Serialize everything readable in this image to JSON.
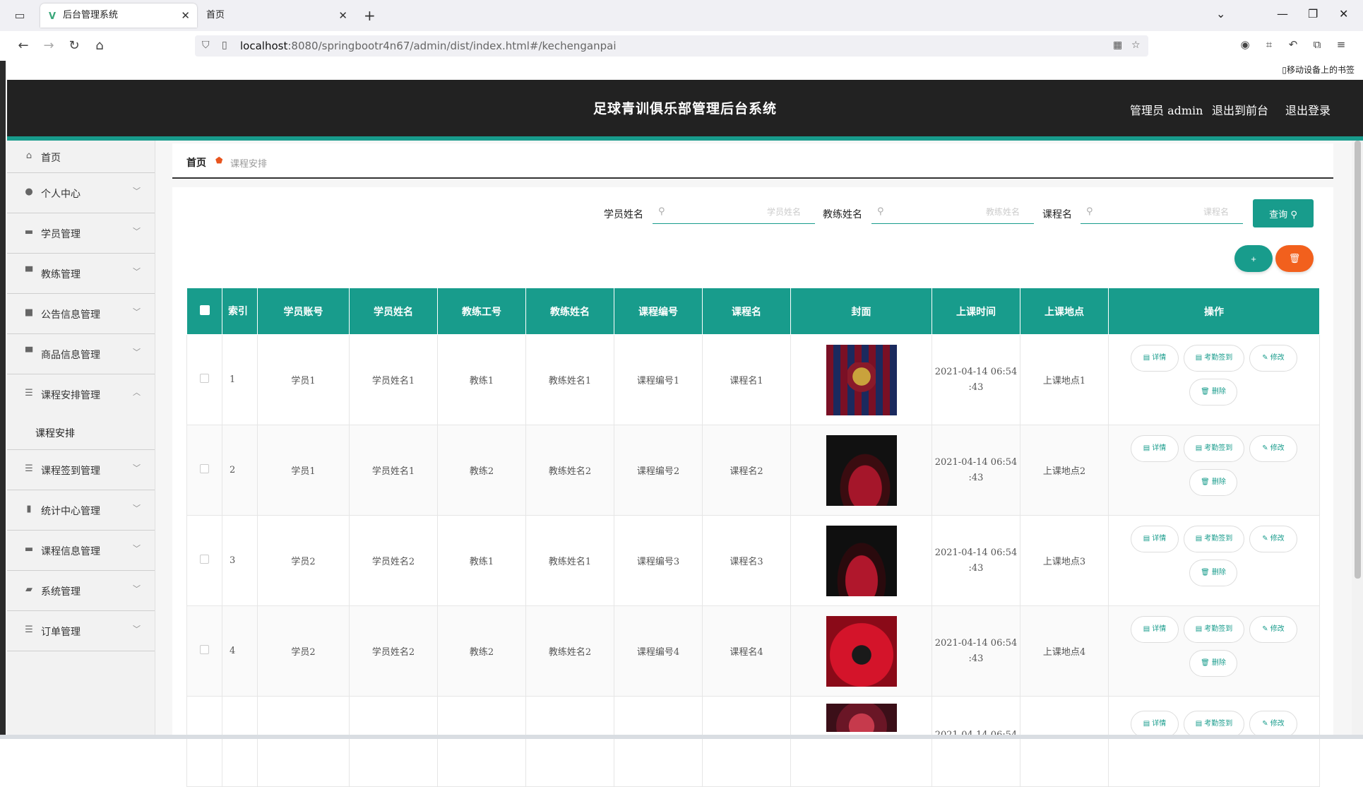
{
  "browser": {
    "tab_active_title": "后台管理系统",
    "tab_inactive_title": "首页",
    "url_host": "localhost",
    "url_rest": ":8080/springbootr4n67/admin/dist/index.html#/kechenganpai",
    "bookmarks_label": "移动设备上的书签"
  },
  "header": {
    "title": "足球青训俱乐部管理后台系统",
    "admin_label": "管理员 admin",
    "front_link": "退出到前台",
    "logout_link": "退出登录"
  },
  "sidebar": {
    "items": [
      {
        "label": "首页",
        "icon": "home-icon"
      },
      {
        "label": "个人中心",
        "icon": "user-icon"
      },
      {
        "label": "学员管理",
        "icon": "briefcase-icon"
      },
      {
        "label": "教练管理",
        "icon": "monitor-icon"
      },
      {
        "label": "公告信息管理",
        "icon": "video-icon"
      },
      {
        "label": "商品信息管理",
        "icon": "monitor-icon"
      },
      {
        "label": "课程安排管理",
        "icon": "sliders-icon"
      },
      {
        "label": "课程签到管理",
        "icon": "list-icon"
      },
      {
        "label": "统计中心管理",
        "icon": "bar-chart-icon"
      },
      {
        "label": "课程信息管理",
        "icon": "message-icon"
      },
      {
        "label": "系统管理",
        "icon": "wallet-icon"
      },
      {
        "label": "订单管理",
        "icon": "list-icon"
      }
    ],
    "sub_item": "课程安排"
  },
  "breadcrumb": {
    "home": "首页",
    "current": "课程安排"
  },
  "search": {
    "student_label": "学员姓名",
    "student_placeholder": "学员姓名",
    "coach_label": "教练姓名",
    "coach_placeholder": "教练姓名",
    "course_label": "课程名",
    "course_placeholder": "课程名",
    "query_label": "查询",
    "add_label": "+",
    "delete_label": "🗑"
  },
  "table": {
    "columns": [
      "索引",
      "学员账号",
      "学员姓名",
      "教练工号",
      "教练姓名",
      "课程编号",
      "课程名",
      "封面",
      "上课时间",
      "上课地点",
      "操作"
    ],
    "rows": [
      {
        "index": "1",
        "account": "学员1",
        "name": "学员姓名1",
        "coach_no": "教练1",
        "coach_name": "教练姓名1",
        "course_no": "课程编号1",
        "course": "课程名1",
        "time_line1": "2021-04-14 06:54",
        "time_line2": ":43",
        "place": "上课地点1"
      },
      {
        "index": "2",
        "account": "学员1",
        "name": "学员姓名1",
        "coach_no": "教练2",
        "coach_name": "教练姓名2",
        "course_no": "课程编号2",
        "course": "课程名2",
        "time_line1": "2021-04-14 06:54",
        "time_line2": ":43",
        "place": "上课地点2"
      },
      {
        "index": "3",
        "account": "学员2",
        "name": "学员姓名2",
        "coach_no": "教练1",
        "coach_name": "教练姓名1",
        "course_no": "课程编号3",
        "course": "课程名3",
        "time_line1": "2021-04-14 06:54",
        "time_line2": ":43",
        "place": "上课地点3"
      },
      {
        "index": "4",
        "account": "学员2",
        "name": "学员姓名2",
        "coach_no": "教练2",
        "coach_name": "教练姓名2",
        "course_no": "课程编号4",
        "course": "课程名4",
        "time_line1": "2021-04-14 06:54",
        "time_line2": ":43",
        "place": "上课地点4"
      },
      {
        "index": "",
        "account": "",
        "name": "",
        "coach_no": "",
        "coach_name": "",
        "course_no": "",
        "course": "",
        "time_line1": "2021-04-14 06:54",
        "time_line2": "",
        "place": ""
      }
    ],
    "actions": {
      "detail": "详情",
      "sign": "考勤签到",
      "edit": "修改",
      "delete": "删除"
    }
  },
  "colors": {
    "accent": "#189c8c",
    "danger": "#f2601d",
    "header_bg": "#222222"
  }
}
